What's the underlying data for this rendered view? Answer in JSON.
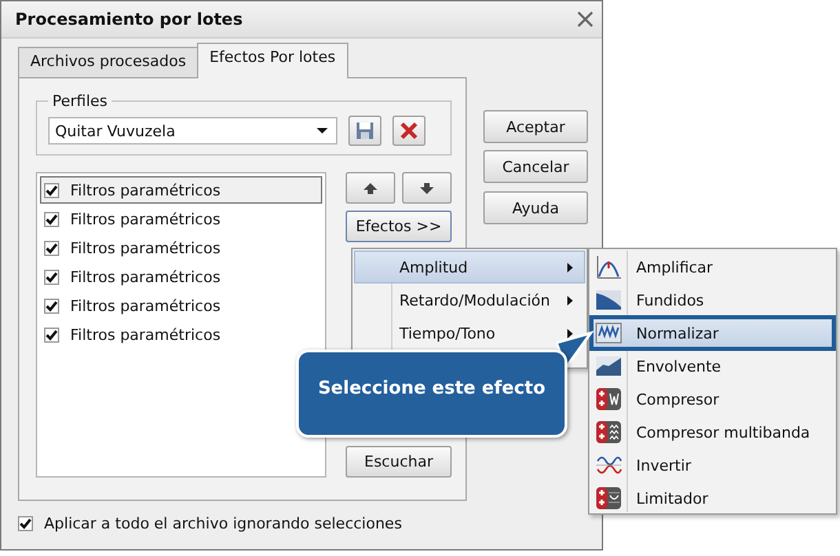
{
  "window": {
    "title": "Procesamiento por lotes"
  },
  "tabs": [
    {
      "label": "Archivos procesados",
      "selected": false
    },
    {
      "label": "Efectos Por lotes",
      "selected": true
    }
  ],
  "profiles": {
    "label": "Perfiles",
    "value": "Quitar Vuvuzela"
  },
  "effects_list": [
    {
      "label": "Filtros paramétricos",
      "checked": true,
      "selected": true
    },
    {
      "label": "Filtros paramétricos",
      "checked": true,
      "selected": false
    },
    {
      "label": "Filtros paramétricos",
      "checked": true,
      "selected": false
    },
    {
      "label": "Filtros paramétricos",
      "checked": true,
      "selected": false
    },
    {
      "label": "Filtros paramétricos",
      "checked": true,
      "selected": false
    },
    {
      "label": "Filtros paramétricos",
      "checked": true,
      "selected": false
    }
  ],
  "effects_button": "Efectos >>",
  "listen_button": "Escuchar",
  "dialog_buttons": [
    "Aceptar",
    "Cancelar",
    "Ayuda"
  ],
  "apply_all": {
    "label": "Aplicar a todo el archivo ignorando selecciones",
    "checked": true
  },
  "menu": [
    {
      "label": "Amplitud",
      "selected": true
    },
    {
      "label": "Retardo/Modulación",
      "selected": false
    },
    {
      "label": "Tiempo/Tono",
      "selected": false
    }
  ],
  "submenu": [
    {
      "label": "Amplificar",
      "kind": "amplify",
      "selected": false
    },
    {
      "label": "Fundidos",
      "kind": "fade",
      "selected": false
    },
    {
      "label": "Normalizar",
      "kind": "normalize",
      "selected": true
    },
    {
      "label": "Envolvente",
      "kind": "envelope",
      "selected": false
    },
    {
      "label": "Compresor",
      "kind": "compressor",
      "selected": false
    },
    {
      "label": "Compresor multibanda",
      "kind": "multiband",
      "selected": false
    },
    {
      "label": "Invertir",
      "kind": "invert",
      "selected": false
    },
    {
      "label": "Limitador",
      "kind": "limiter",
      "selected": false
    }
  ],
  "callout": {
    "text": "Seleccione este efecto"
  }
}
